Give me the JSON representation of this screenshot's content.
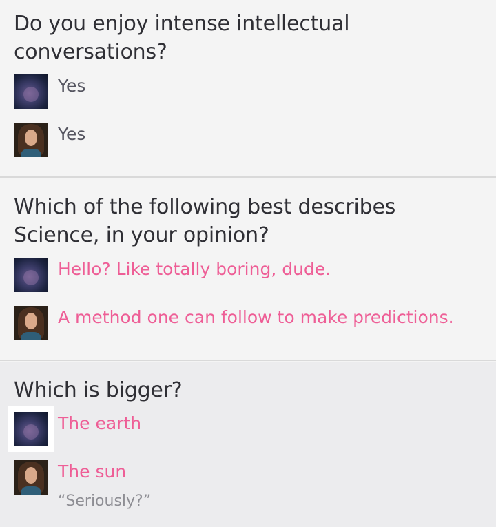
{
  "questions": [
    {
      "question": "Do you enjoy intense intellectual conversations?",
      "answers": [
        {
          "avatar": "blurred-user-avatar",
          "text": "Yes"
        },
        {
          "avatar": "woman-user-avatar",
          "text": "Yes"
        }
      ]
    },
    {
      "question": "Which of the following best describes Science, in your opinion?",
      "answers": [
        {
          "avatar": "blurred-user-avatar",
          "text": "Hello? Like totally boring, dude."
        },
        {
          "avatar": "woman-user-avatar",
          "text": "A method one can follow to make predictions."
        }
      ]
    },
    {
      "question": "Which is bigger?",
      "answers": [
        {
          "avatar": "blurred-user-avatar",
          "text": "The earth"
        },
        {
          "avatar": "woman-user-avatar",
          "text": "The sun"
        }
      ],
      "comment": "“Seriously?”"
    }
  ],
  "colors": {
    "background": "#f4f4f4",
    "highlighted_card": "#ececee",
    "question_text": "#2f2f35",
    "neutral_answer": "#555560",
    "mismatch_answer": "#ee5e96",
    "comment_text": "#8e8e94"
  }
}
